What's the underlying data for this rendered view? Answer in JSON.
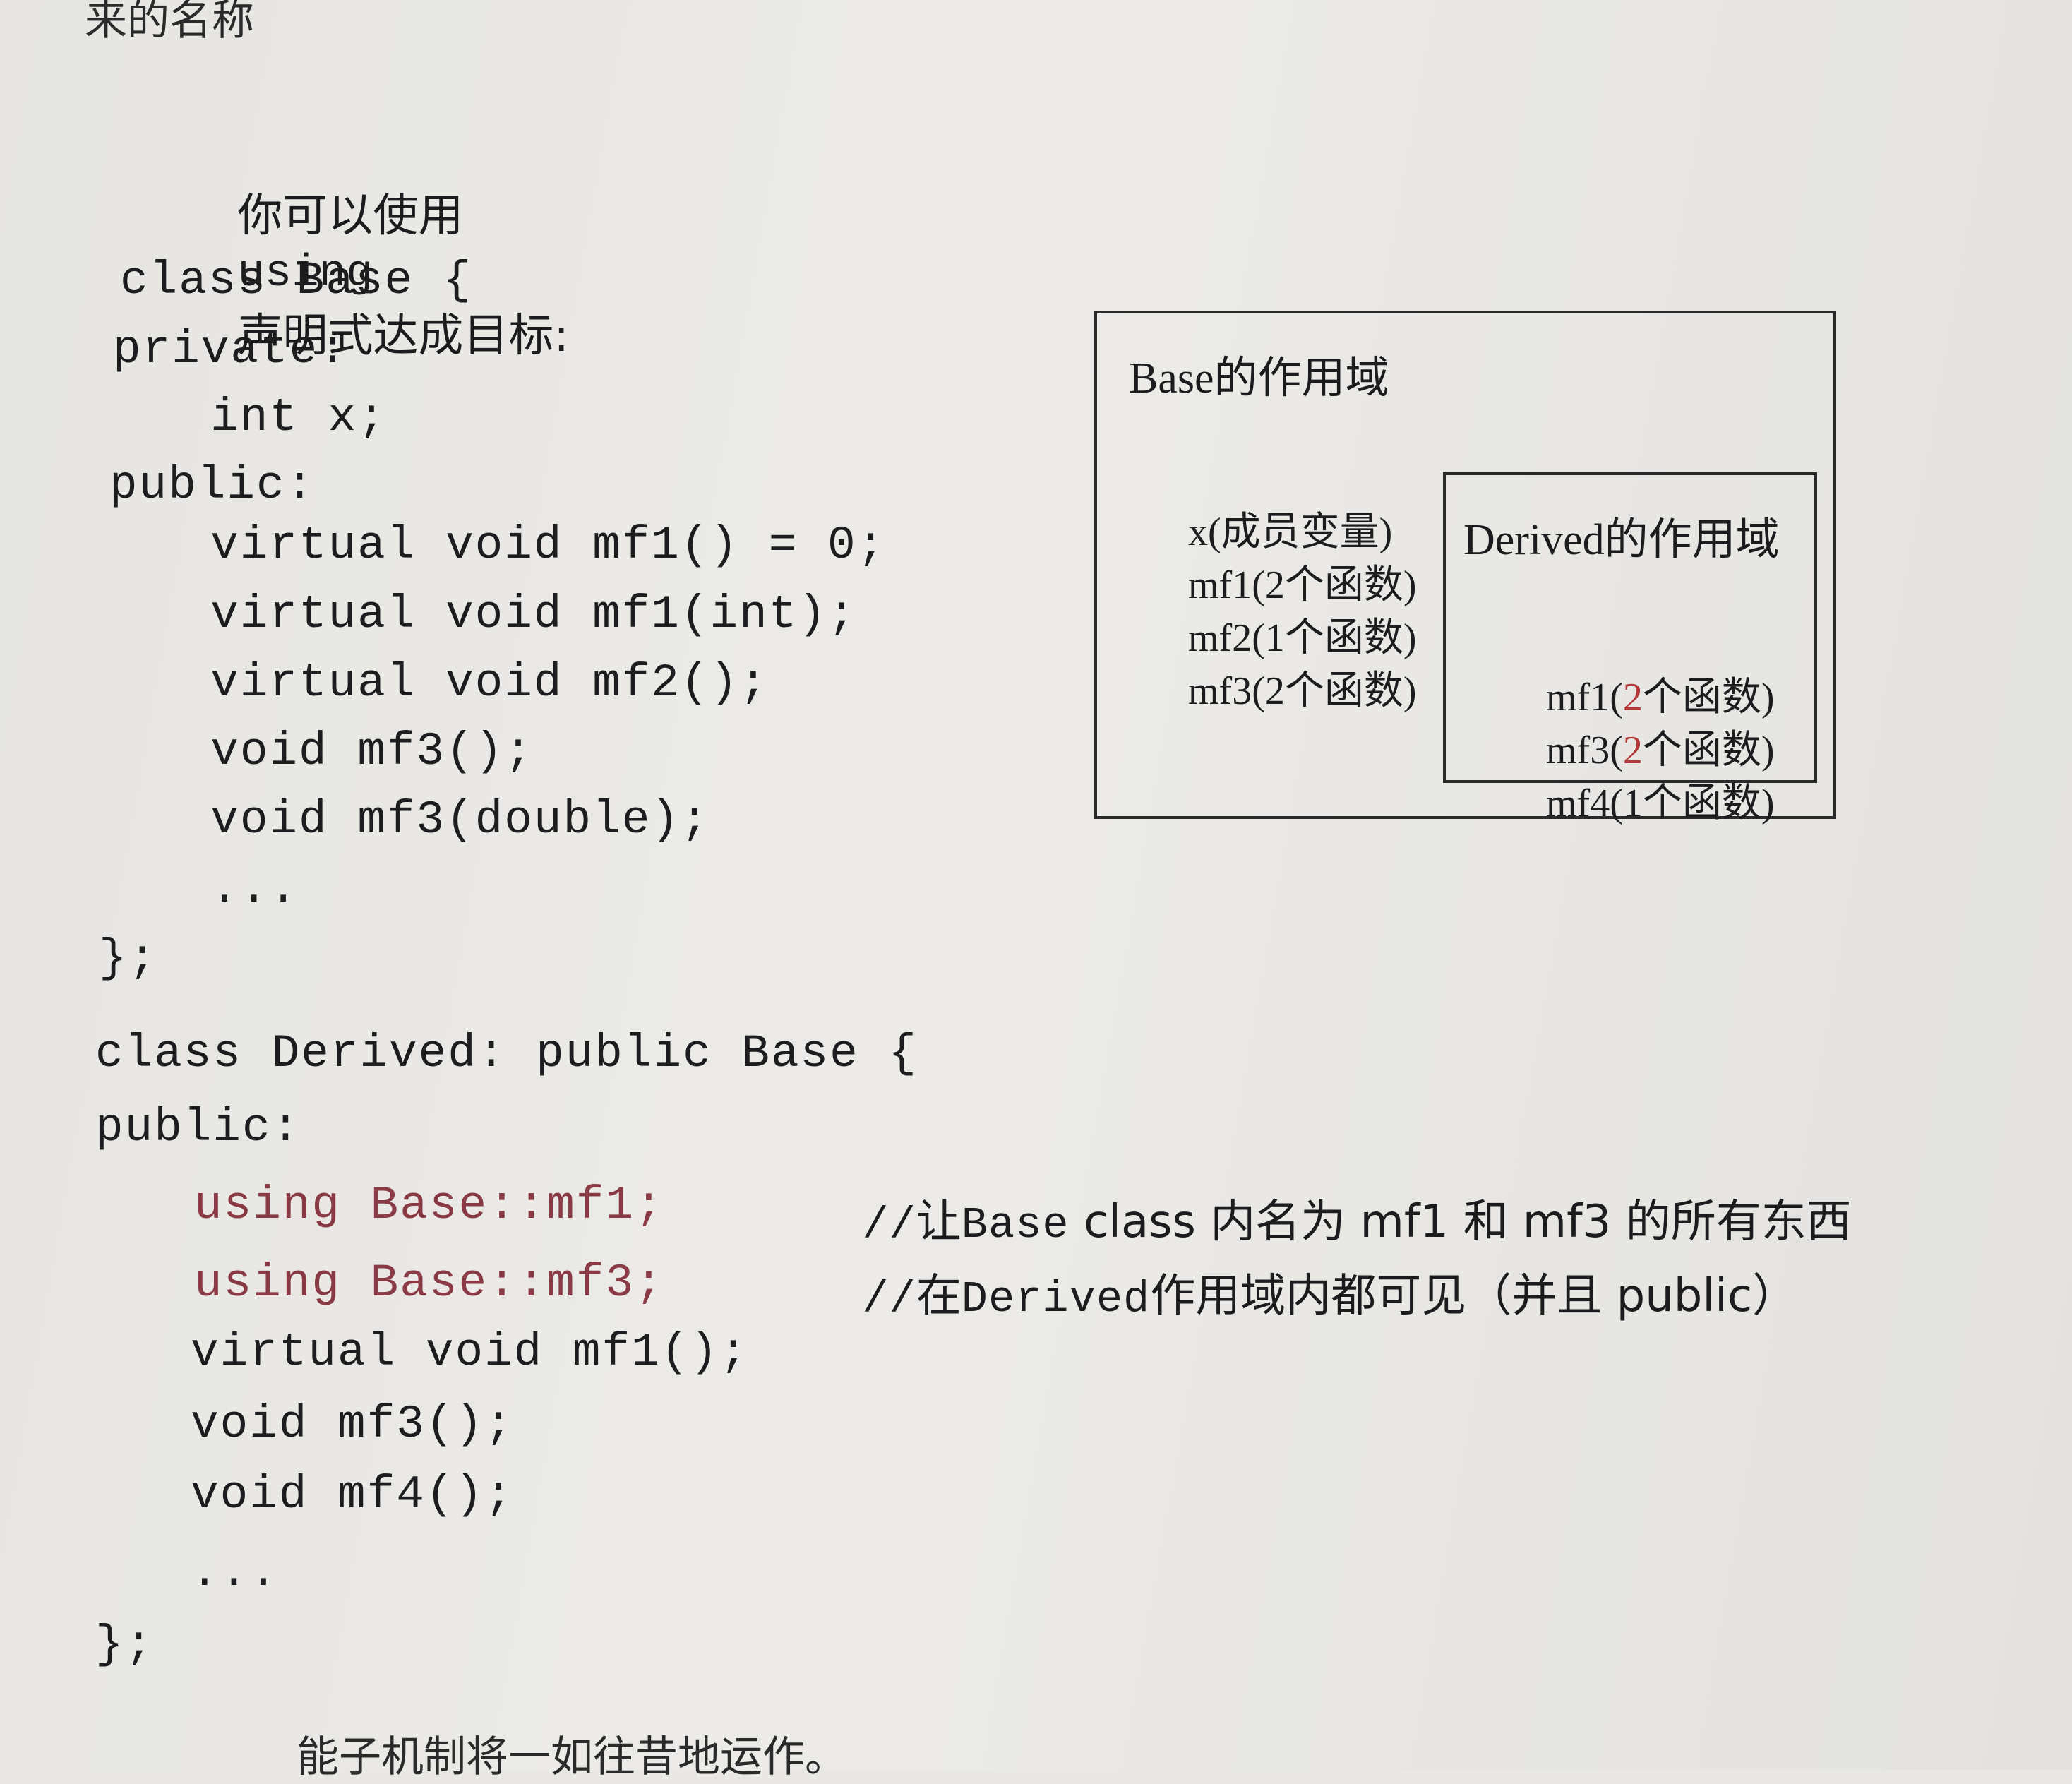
{
  "top_fragment": "来的名称",
  "intro": {
    "before": "你可以使用",
    "keyword": "using",
    "after": "声明式达成目标:"
  },
  "code": {
    "base": [
      "class Base {",
      "private:",
      "  int x;",
      "public:",
      "  virtual void mf1() = 0;",
      "  virtual void mf1(int);",
      "  virtual void mf2();",
      "  void mf3();",
      "  void mf3(double);",
      "  ...",
      "};"
    ],
    "derived_head": [
      "class Derived: public Base {",
      "public:"
    ],
    "using_lines": [
      "using Base::mf1;",
      "using Base::mf3;"
    ],
    "derived_tail": [
      "virtual void mf1();",
      "void mf3();",
      "void mf4();",
      "...",
      "};"
    ]
  },
  "comments": {
    "line1": {
      "slashes": "//",
      "pre": "让",
      "mono": "Base",
      "post": " class 内名为 mf1 和 mf3 的所有东西"
    },
    "line2": {
      "slashes": "//",
      "pre": "在",
      "mono": "Derived",
      "post": "作用域内都可见（并且 public）"
    }
  },
  "diagram": {
    "base_scope": {
      "title": "Base的作用域",
      "items": [
        {
          "name": "x",
          "note": "(成员变量)"
        },
        {
          "name": "mf1",
          "note": "(2个函数)"
        },
        {
          "name": "mf2",
          "note": "(1个函数)"
        },
        {
          "name": "mf3",
          "note": "(2个函数)"
        }
      ]
    },
    "derived_scope": {
      "title": "Derived的作用域",
      "items": [
        {
          "name": "mf1(",
          "count": "2",
          "rest": "个函数)"
        },
        {
          "name": "mf3(",
          "count": "2",
          "rest": "个函数)"
        },
        {
          "name": "mf4(",
          "count": "1",
          "rest": "个函数)"
        }
      ]
    }
  },
  "bottom_fragment": "能子机制将一如往昔地运作。"
}
